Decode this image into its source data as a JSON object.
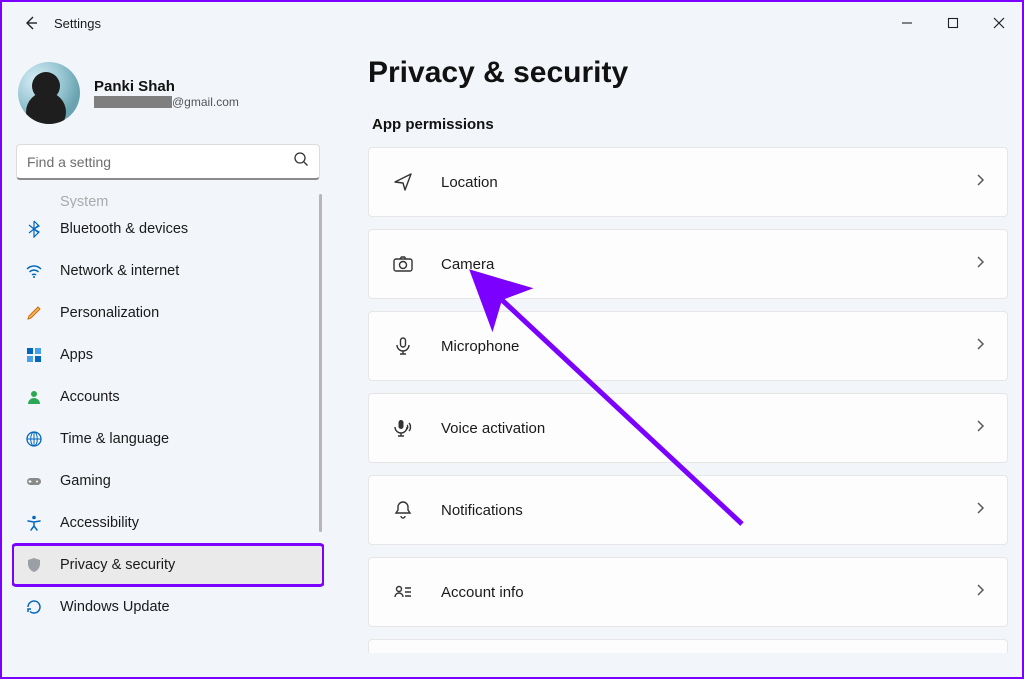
{
  "titlebar": {
    "title": "Settings"
  },
  "user": {
    "name": "Panki Shah",
    "email_suffix": "@gmail.com"
  },
  "search": {
    "placeholder": "Find a setting"
  },
  "nav": {
    "items": [
      {
        "id": "system",
        "label": "System"
      },
      {
        "id": "bluetooth",
        "label": "Bluetooth & devices"
      },
      {
        "id": "network",
        "label": "Network & internet"
      },
      {
        "id": "personalize",
        "label": "Personalization"
      },
      {
        "id": "apps",
        "label": "Apps"
      },
      {
        "id": "accounts",
        "label": "Accounts"
      },
      {
        "id": "time",
        "label": "Time & language"
      },
      {
        "id": "gaming",
        "label": "Gaming"
      },
      {
        "id": "accessibility",
        "label": "Accessibility"
      },
      {
        "id": "privacy",
        "label": "Privacy & security"
      },
      {
        "id": "update",
        "label": "Windows Update"
      }
    ],
    "selected": "privacy"
  },
  "page": {
    "title": "Privacy & security",
    "section": "App permissions",
    "items": [
      {
        "id": "location",
        "label": "Location"
      },
      {
        "id": "camera",
        "label": "Camera"
      },
      {
        "id": "microphone",
        "label": "Microphone"
      },
      {
        "id": "voice",
        "label": "Voice activation"
      },
      {
        "id": "notifications",
        "label": "Notifications"
      },
      {
        "id": "account-info",
        "label": "Account info"
      }
    ]
  }
}
